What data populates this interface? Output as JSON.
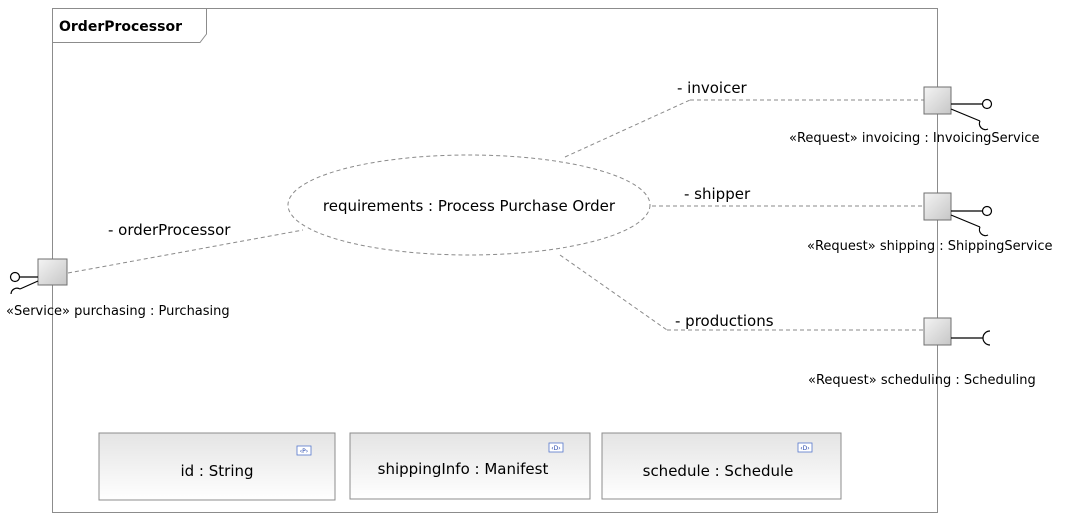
{
  "component": {
    "name": "OrderProcessor"
  },
  "collaboration": {
    "label": "requirements : Process Purchase Order"
  },
  "connectors": {
    "order_processor": "- orderProcessor",
    "invoicer": "- invoicer",
    "shipper": "- shipper",
    "productions": "- productions"
  },
  "ports": {
    "purchasing": "«Service» purchasing : Purchasing",
    "invoicing": "«Request» invoicing : InvoicingService",
    "shipping": "«Request» shipping : ShippingService",
    "scheduling": "«Request» scheduling : Scheduling"
  },
  "attributes": [
    {
      "label": "id : String",
      "badge": "‹P›"
    },
    {
      "label": "shippingInfo : Manifest",
      "badge": "‹D›"
    },
    {
      "label": "schedule : Schedule",
      "badge": "‹D›"
    }
  ],
  "colors": {
    "frame_border": "#8c8c8c",
    "connector": "#8a8a8a",
    "badge": "#2244aa"
  }
}
